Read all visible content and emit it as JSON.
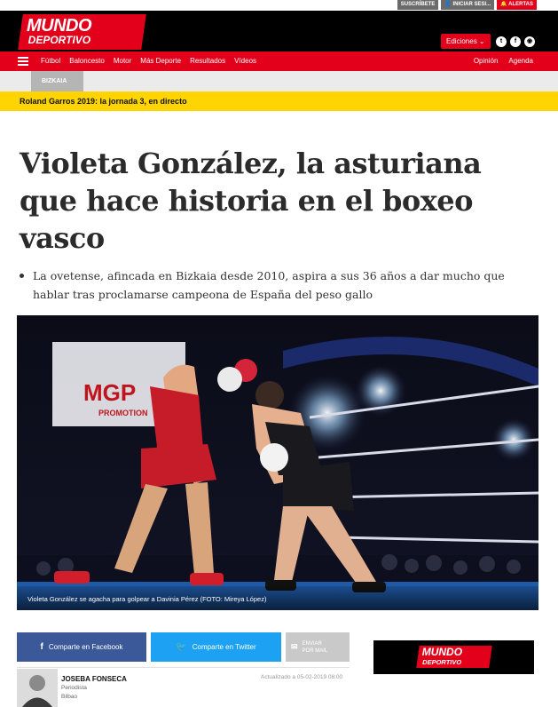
{
  "topbar": {
    "subscribe": "SUSCRÍBETE",
    "login": "INICIAR SESI...",
    "alerts": "ALERTAS"
  },
  "masthead": {
    "logo_top": "MUNDO",
    "logo_bottom": "DEPORTIVO",
    "ediciones": "Ediciones",
    "social": [
      "twitter-icon",
      "facebook-icon",
      "rss-icon"
    ]
  },
  "nav": {
    "items": [
      "Fútbol",
      "Baloncesto",
      "Motor",
      "Más Deporte",
      "Resultados",
      "Vídeos"
    ],
    "right": [
      "Opinión",
      "Agenda"
    ]
  },
  "subnav": {
    "section": "BIZKAIA"
  },
  "breaking": {
    "text": "Roland Garros 2019: la jornada 3, en directo"
  },
  "article": {
    "title": "Violeta González, la asturiana que hace historia en el boxeo vasco",
    "subtitle": "La ovetense, afincada en Bizkaia desde 2010, aspira a sus 36 años a dar mucho que hablar tras proclamarse campeona de España del peso gallo",
    "photo_caption": "Violeta González se agacha para golpear a Davinia Pérez (FOTO: Mireya López)",
    "banner_text": "MGP",
    "banner_sub": "PROMOTION"
  },
  "share": {
    "facebook": "Comparte en Facebook",
    "twitter": "Comparte en Twitter",
    "mail": "ENVIAR POR MAIL"
  },
  "author": {
    "name": "JOSEBA FONSECA",
    "role": "Periodista",
    "city": "Bilbao",
    "updated": "Actualizado a 05-02-2019 08:00"
  },
  "sidead": {
    "logo_top": "MUNDO",
    "logo_bottom": "DEPORTIVO"
  },
  "colors": {
    "brand_red": "#e2001a",
    "breaking_yellow": "#ffd400",
    "facebook_blue": "#3b5998",
    "twitter_blue": "#1da1f2"
  }
}
